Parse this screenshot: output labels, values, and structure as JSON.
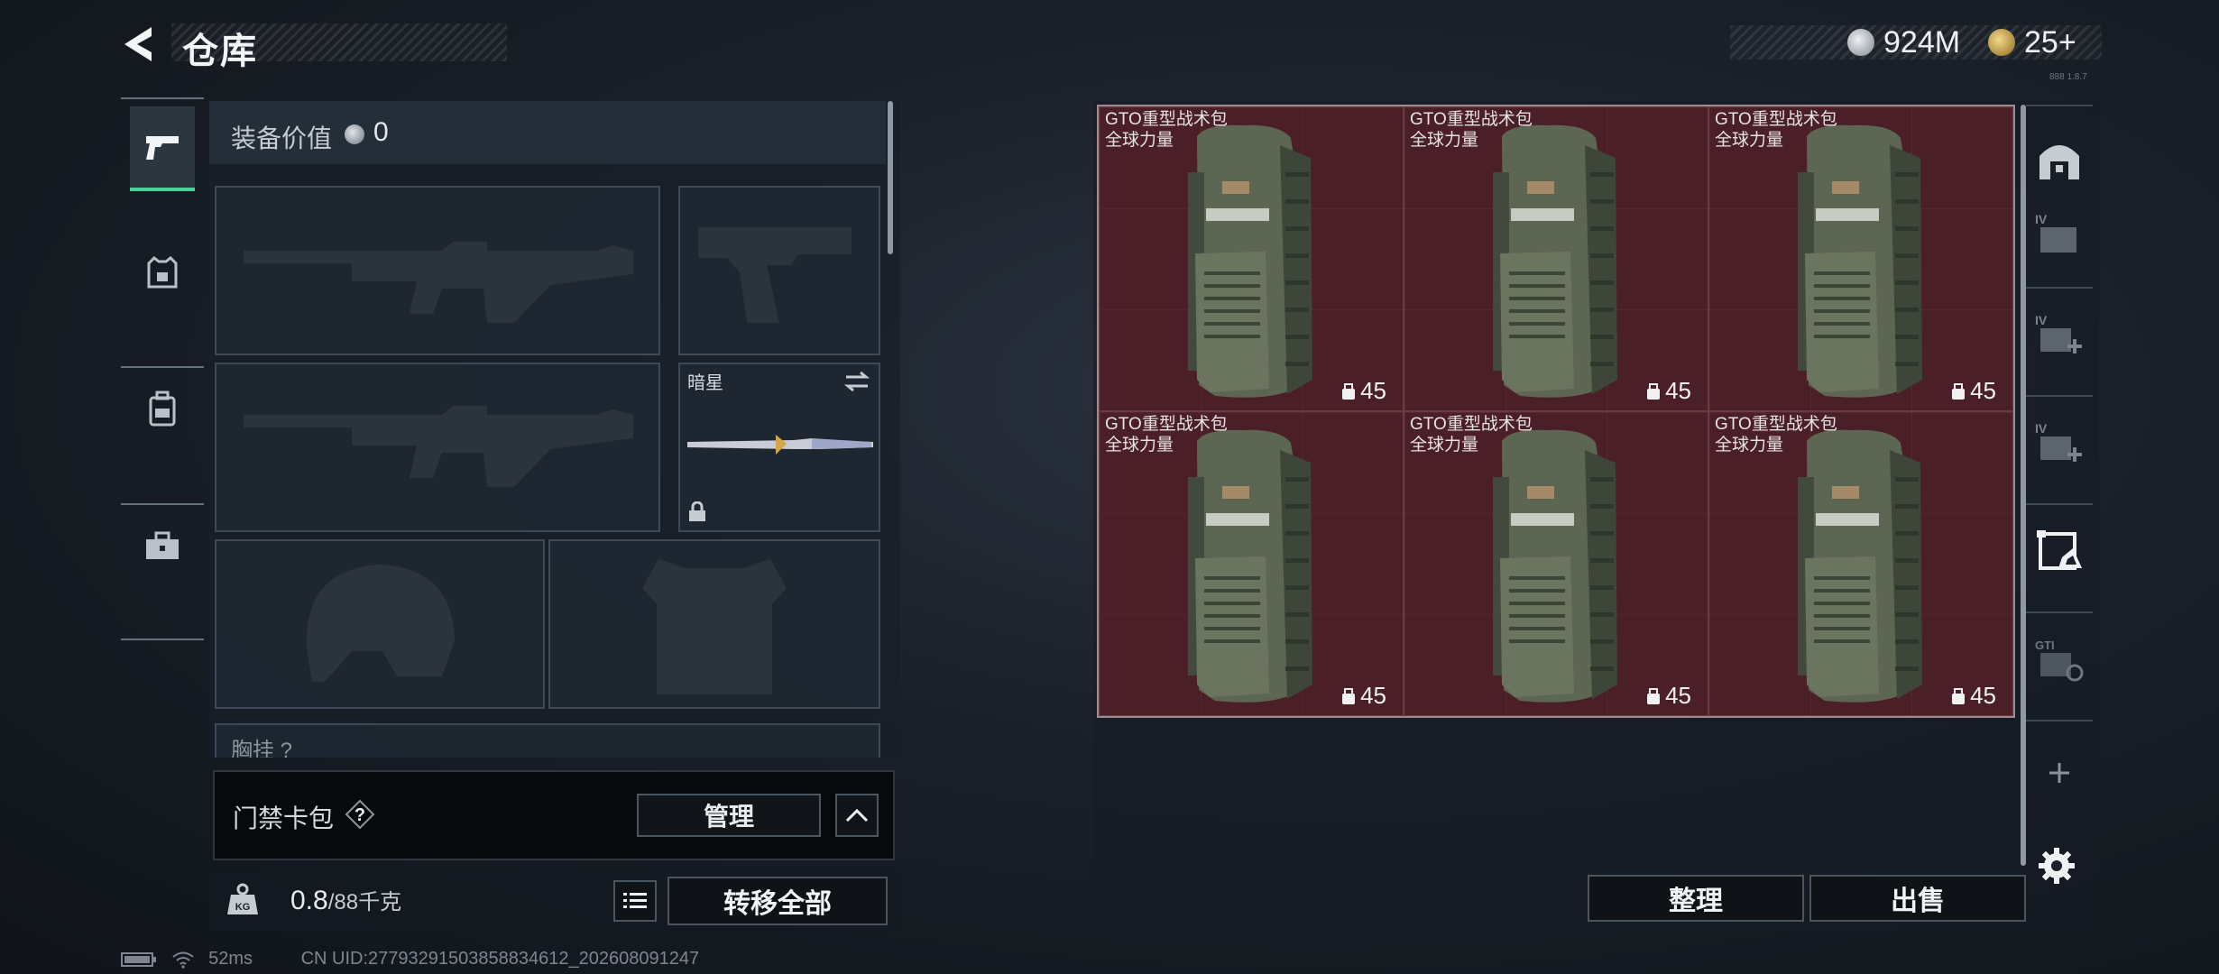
{
  "header": {
    "title": "仓库",
    "currency1": {
      "value": "924M",
      "icon": "silver-coin-icon",
      "color": "#c8cdd2"
    },
    "currency2": {
      "value": "25+",
      "icon": "gold-coin-icon",
      "color": "#c9a45a"
    },
    "version": "888 1.8.7"
  },
  "left_rail": {
    "items": [
      {
        "name": "weapon",
        "icon": "pistol-icon",
        "active": true
      },
      {
        "name": "armor",
        "icon": "vest-icon",
        "active": false
      },
      {
        "name": "backpack",
        "icon": "backpack-icon",
        "active": false
      },
      {
        "name": "tools",
        "icon": "toolbox-icon",
        "active": false
      }
    ]
  },
  "loadout": {
    "title": "装备价值",
    "value": "0",
    "knife_name": "暗星",
    "partial_label": "胸挂 ?"
  },
  "cardbag": {
    "title": "门禁卡包",
    "manage_label": "管理"
  },
  "weight": {
    "current": "0.8",
    "max": "/88千克",
    "transfer_label": "转移全部"
  },
  "storage": {
    "items": [
      {
        "line1": "GTO重型战术包",
        "line2": "全球力量",
        "capacity": "45"
      },
      {
        "line1": "GTO重型战术包",
        "line2": "全球力量",
        "capacity": "45"
      },
      {
        "line1": "GTO重型战术包",
        "line2": "全球力量",
        "capacity": "45"
      },
      {
        "line1": "GTO重型战术包",
        "line2": "全球力量",
        "capacity": "45"
      },
      {
        "line1": "GTO重型战术包",
        "line2": "全球力量",
        "capacity": "45"
      },
      {
        "line1": "GTO重型战术包",
        "line2": "全球力量",
        "capacity": "45"
      }
    ],
    "sort_label": "整理",
    "sell_label": "出售"
  },
  "right_rail": {
    "items": [
      "vault-icon",
      "case-iv-icon",
      "case-iv-add-icon",
      "case-iv-add-icon",
      "storage-box-icon",
      "gti-case-icon",
      "add-icon",
      "settings-icon"
    ]
  },
  "footer": {
    "ping": "52ms",
    "uid": "CN UID:27793291503858834612_202608091247"
  }
}
